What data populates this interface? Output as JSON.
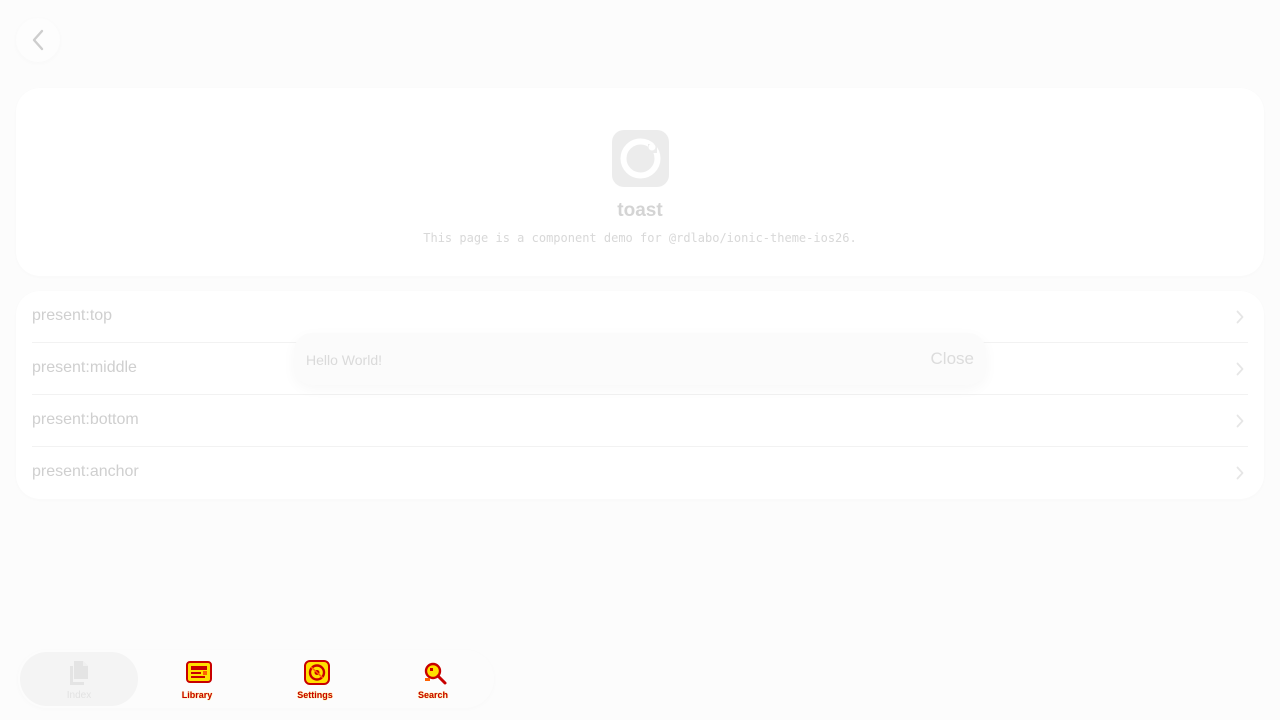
{
  "header": {
    "back_icon": "chevron-left-icon"
  },
  "hero": {
    "icon": "toast-app-icon",
    "title": "toast",
    "description": "This page is a component demo for @rdlabo/ionic-theme-ios26."
  },
  "list": {
    "items": [
      {
        "label": "present:top"
      },
      {
        "label": "present:middle"
      },
      {
        "label": "present:bottom"
      },
      {
        "label": "present:anchor"
      }
    ],
    "chevron_icon": "chevron-right-icon"
  },
  "toast": {
    "message": "Hello World!",
    "close_label": "Close"
  },
  "tabs": [
    {
      "label": "Index",
      "icon": "documents-icon",
      "active": true
    },
    {
      "label": "Library",
      "icon": "library-icon",
      "active": false
    },
    {
      "label": "Settings",
      "icon": "settings-icon",
      "active": false
    },
    {
      "label": "Search",
      "icon": "search-icon",
      "active": false
    }
  ],
  "colors": {
    "background": "#fcfcfc",
    "card": "#ffffff",
    "glitch_red": "#c80000",
    "glitch_yellow": "#ffe000"
  }
}
